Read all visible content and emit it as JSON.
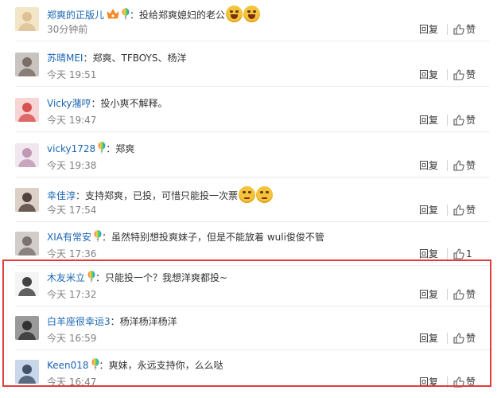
{
  "comments": [
    {
      "username": "郑爽的正版儿",
      "badges": [
        "vip-crown-icon",
        "rainbow-balloon-icon"
      ],
      "text": "投给郑爽媳妇的老公",
      "emojis": [
        "laugh-emoji-icon",
        "laugh-emoji-icon"
      ],
      "time": "30分钟前",
      "reply": "回复",
      "like": "赞",
      "like_count": ""
    },
    {
      "username": "苏晴MEI",
      "badges": [],
      "text": "郑爽、TFBOYS、杨洋",
      "emojis": [],
      "time": "今天 19:51",
      "reply": "回复",
      "like": "赞",
      "like_count": ""
    },
    {
      "username": "Vicky潴哼",
      "badges": [],
      "text": "投小爽不解释。",
      "emojis": [],
      "time": "今天 19:47",
      "reply": "回复",
      "like": "赞",
      "like_count": ""
    },
    {
      "username": "vicky1728",
      "badges": [
        "rainbow-balloon-icon"
      ],
      "text": "郑爽",
      "emojis": [],
      "time": "今天 19:38",
      "reply": "回复",
      "like": "赞",
      "like_count": ""
    },
    {
      "username": "幸佳淳",
      "badges": [],
      "text": "支持郑爽，已投，可惜只能投一次票",
      "emojis": [
        "sad-emoji-icon",
        "sad-emoji-icon"
      ],
      "time": "今天 17:54",
      "reply": "回复",
      "like": "赞",
      "like_count": ""
    },
    {
      "username": "XIA有常安",
      "badges": [
        "rainbow-balloon-icon"
      ],
      "text": "虽然特别想投爽妹子，但是不能放着 wuli俊俊不管",
      "emojis": [],
      "time": "今天 17:36",
      "reply": "回复",
      "like": "",
      "like_count": "1"
    },
    {
      "username": "木友米立",
      "badges": [
        "rainbow-balloon-icon"
      ],
      "text": "只能投一个？我想洋爽都投~",
      "emojis": [],
      "time": "今天 17:32",
      "reply": "回复",
      "like": "赞",
      "like_count": ""
    },
    {
      "username": "白羊座很幸运3",
      "badges": [],
      "text": "杨洋杨洋杨洋",
      "emojis": [],
      "time": "今天 16:59",
      "reply": "回复",
      "like": "赞",
      "like_count": ""
    },
    {
      "username": "Keen018",
      "badges": [
        "rainbow-balloon-icon"
      ],
      "text": "爽妹，永远支持你，么么哒",
      "emojis": [],
      "time": "今天 16:47",
      "reply": "回复",
      "like": "赞",
      "like_count": ""
    }
  ],
  "separator": "：",
  "colors": {
    "username": "#1a66b3",
    "time": "#808080",
    "highlight_border": "#e23b3b"
  }
}
